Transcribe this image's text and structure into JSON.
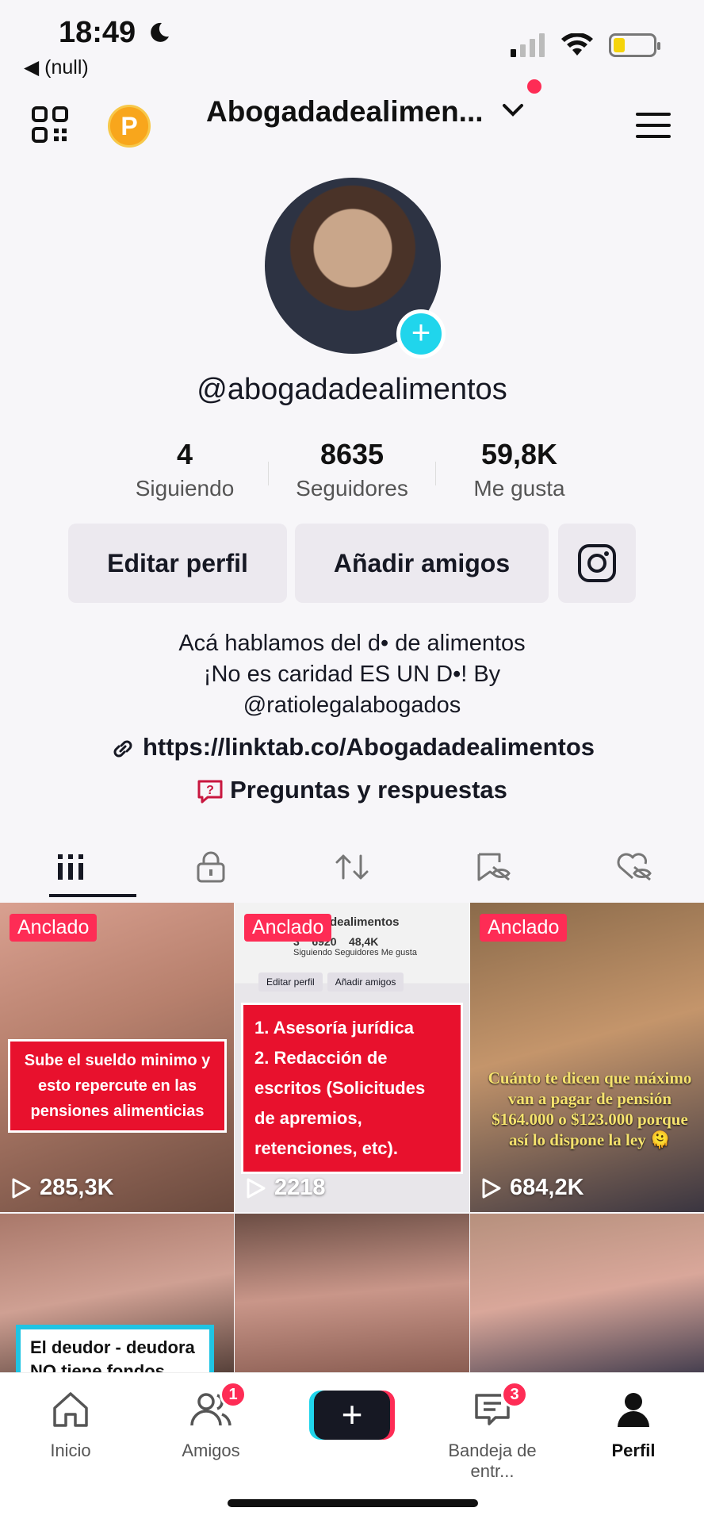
{
  "status_bar": {
    "time": "18:49",
    "back_label": "◀ (null)"
  },
  "header": {
    "account_name": "Abogadadealimen...",
    "points_badge": "P"
  },
  "profile": {
    "handle": "@abogadadealimentos",
    "stats": [
      {
        "value": "4",
        "label": "Siguiendo"
      },
      {
        "value": "8635",
        "label": "Seguidores"
      },
      {
        "value": "59,8K",
        "label": "Me gusta"
      }
    ],
    "edit_button": "Editar perfil",
    "add_friends_button": "Añadir amigos",
    "bio_lines": [
      "Acá hablamos del d• de alimentos",
      "¡No es caridad ES UN D•! By",
      "@ratiolegalabogados"
    ],
    "link": "https://linktab.co/Abogadadealimentos",
    "qa_label": "Preguntas y respuestas"
  },
  "videos": [
    {
      "pinned": "Anclado",
      "views": "285,3K",
      "overlay": "Sube el sueldo minimo y esto repercute en las pensiones alimenticias"
    },
    {
      "pinned": "Anclado",
      "views": "2218",
      "overlay_lines": [
        "1. Asesoría jurídica",
        "2. Redacción de",
        "escritos (Solicitudes",
        "de apremios,",
        "retenciones, etc)."
      ],
      "mini_header": "dealimentos",
      "mini_stats": "3    6920    48,4K",
      "mini_labels": "Siguiendo  Seguidores  Me gusta",
      "mini_edit": "Editar perfil",
      "mini_add": "Añadir amigos"
    },
    {
      "pinned": "Anclado",
      "views": "684,2K",
      "overlay": "Cuánto te dicen que máximo van a pagar de pensión $164.000 o $123.000 porque así lo dispone la ley 🫠"
    },
    {
      "overlay": "El deudor - deudora NO tiene fondos"
    },
    {},
    {}
  ],
  "bottom_nav": {
    "items": [
      {
        "label": "Inicio"
      },
      {
        "label": "Amigos",
        "badge": "1"
      },
      {
        "label": "+"
      },
      {
        "label": "Bandeja de entr...",
        "badge": "3"
      },
      {
        "label": "Perfil"
      }
    ]
  },
  "colors": {
    "accent": "#fe2c55",
    "cyan": "#20d5ec",
    "text": "#161823"
  }
}
